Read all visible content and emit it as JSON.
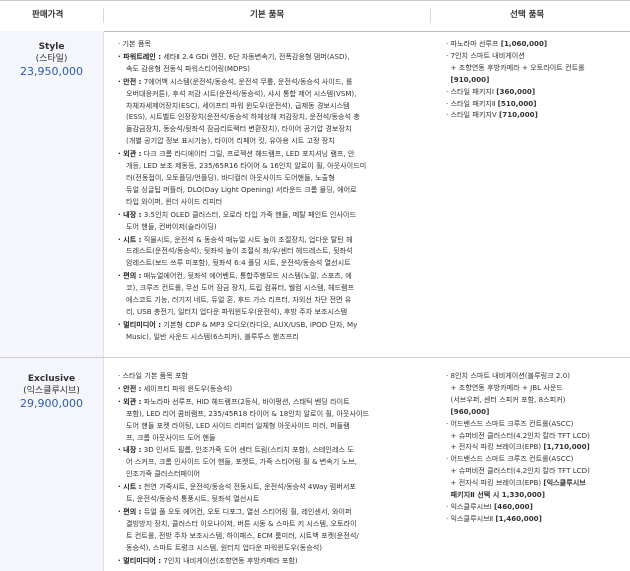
{
  "header": {
    "col1": "판매가격",
    "col2": "기본 품목",
    "col3": "선택 품목"
  },
  "rows": [
    {
      "trim": "Style",
      "trim_ko": "(스타일)",
      "price": "23,950,000",
      "basic": [
        {
          "b": "",
          "t": "· 기본 품목"
        },
        {
          "b": "· 파워트레인 :",
          "t": " 세타Ⅱ 2.4 GDi 엔진, 6단 자동변속기, 전폭감응형 댐퍼(ASD),"
        },
        {
          "b": "",
          "t": "속도 감응형 전동식 파워스티어링(MDPS)",
          "i": 1
        },
        {
          "b": "· 안전 :",
          "t": " 7에어백 시스템(운전석/동승석, 운전석 무릎, 운전석/동승석 사이드, 롤"
        },
        {
          "b": "",
          "t": "오버대응커튼), 후석 저감 시트(운전석/동승석), 샤시 통합 제어 시스템(VSM),",
          "i": 1
        },
        {
          "b": "",
          "t": "차체자세제어장치(ESC), 세이프티 파워 윈도우(운전석), 급제동 경보시스템",
          "i": 1
        },
        {
          "b": "",
          "t": "(ESS), 시트벨트 인장장치(운전석/동승석 하체상해 저감장치, 운전석/동승석 충",
          "i": 1
        },
        {
          "b": "",
          "t": "돌감금장치, 동승석/뒷좌석 잠금리트랙터 변환장치), 타이어 공기압 경보장치",
          "i": 1
        },
        {
          "b": "",
          "t": "(개별 공기압 정보 표시기능), 타이어 리페어 킷, 유아용 시트 고정 장치",
          "i": 1
        },
        {
          "b": "· 외관 :",
          "t": " 다크 크롬 라디에이터 그릴, 프로젝션 헤드램프, LED 포지셔닝 램프, 안"
        },
        {
          "b": "",
          "t": "개등, LED 보조 제동등, 235/65R16 타이어 & 16인치 알로이 휠, 아웃사이드미",
          "i": 1
        },
        {
          "b": "",
          "t": "러(전동접이, 오토플딩/언플딩), 바디컬러 아웃사이드 도어핸들, 노출형",
          "i": 1
        },
        {
          "b": "",
          "t": "듀얼 싱글팁 머플러, DLO(Day Light Opening) 서라운드 크롬 몰딩, 에어로",
          "i": 1
        },
        {
          "b": "",
          "t": "타입 와이퍼, 윈더 사이드 리피터",
          "i": 1
        },
        {
          "b": "· 내장 :",
          "t": " 3.5인치 OLED 클러스터, 오로라 타입 가죽 핸들, 메탈 페인트 인사이드"
        },
        {
          "b": "",
          "t": "도어 핸들, 컨버이저(슬라이딩)",
          "i": 1
        },
        {
          "b": "· 시트 :",
          "t": " 직물시트, 운전석 & 동승석 매뉴얼 시트 높이 조절장치, 업다운 탈틴 헤"
        },
        {
          "b": "",
          "t": "드레스트(운전석/동승석), 뒷좌석 높이 조절식 좌/우/센터 헤드레스트, 뒷좌석",
          "i": 1
        },
        {
          "b": "",
          "t": "암레스트(보드 쓰루 미포함), 뒷좌석 6:4 폴딩 시트, 운전석/동승석 열선시트",
          "i": 1
        },
        {
          "b": "· 편의 :",
          "t": " 매뉴얼에어컨, 뒷좌석 에어벤트, 통합주행모드 시스템(노말, 스포츠, 에"
        },
        {
          "b": "",
          "t": "코), 크루즈 컨트롤, 무선 도어 잠금 장치, 트립 컴퓨터, 웰컴 시스템, 헤드램프",
          "i": 1
        },
        {
          "b": "",
          "t": "에스코트 기능, 러기지 네트, 듀얼 혼, 후드 가스 리프터, 자외선 차단 전면 유",
          "i": 1
        },
        {
          "b": "",
          "t": "리, USB 충전기, 일터치 업다운 파워윈도우(운전석), 후방 주차 보조시스템",
          "i": 1
        },
        {
          "b": "· 멀티미디어 :",
          "t": " 기본형 CDP & MP3 오디오(라디오, AUX/USB, iPOD 단자, My"
        },
        {
          "b": "",
          "t": "Music), 일반 사운드 시스템(6스피커), 블루투스 핸즈프리",
          "i": 1
        }
      ],
      "options": [
        {
          "t": "· 파노라마 선루프 ",
          "p": "[1,060,000]"
        },
        {
          "t": "· 7인치 스마트 내비게이션",
          "p": ""
        },
        {
          "t": "  + 조향연동 후방카메라 + 오토라이트 컨트롤",
          "p": ""
        },
        {
          "t": "  ",
          "p": "[910,000]"
        },
        {
          "t": "· 스타일 패키지Ⅰ ",
          "p": "[360,000]"
        },
        {
          "t": "· 스타일 패키지Ⅱ ",
          "p": "[510,000]"
        },
        {
          "t": "· 스타일 패키지Ⅴ ",
          "p": "[710,000]"
        }
      ]
    },
    {
      "trim": "Exclusive",
      "trim_ko": "(익스클루시브)",
      "price": "29,900,000",
      "basic": [
        {
          "b": "",
          "t": "· 스타일 기본 품목 포함"
        },
        {
          "b": "· 안전 :",
          "t": " 세이프티 파워 윈도우(동승석)"
        },
        {
          "b": "· 외관 :",
          "t": " 파노라마 선루프, HID 헤드램프(2등식, 바이펑션, 스태틱 벤딩 라이트"
        },
        {
          "b": "",
          "t": "포함), LED 리어 콤비램프, 235/45R18 타이어 & 18인치 알로이 휠, 아웃사이드",
          "i": 1
        },
        {
          "b": "",
          "t": "도어 핸들 포켓 라이팅, LED 사이드 리피터 일체형 아웃사이드 미러, 퍼들램",
          "i": 1
        },
        {
          "b": "",
          "t": "프, 크롬 아웃사이드 도어 핸들",
          "i": 1
        },
        {
          "b": "· 내장 :",
          "t": " 3D 인서트 필름, 인조가죽 도어 센터 트림(스티치 포함), 스테인레스 도"
        },
        {
          "b": "",
          "t": "어 스커프, 크롬 인사이드 도어 핸들, 포켓트, 가죽 스티어링 휠 & 변속기 노브,",
          "i": 1
        },
        {
          "b": "",
          "t": "인조가죽 클러스터페이어",
          "i": 1
        },
        {
          "b": "· 시트 :",
          "t": " 천연 가죽시트, 운전석/동승석 전동시트, 운전석/동승석 4Way 럼버서포"
        },
        {
          "b": "",
          "t": "트, 운전석/동승석 통풍시트, 뒷좌석 열선시트",
          "i": 1
        },
        {
          "b": "· 편의 :",
          "t": " 듀얼 풀 오토 에어컨, 오토 디포그, 열선 스티어링 휠, 레인센서, 와이퍼"
        },
        {
          "b": "",
          "t": "결빙방지 장치, 클러스터 이오나이저, 버튼 시동 & 스마트 키 시스템, 오토라이",
          "i": 1
        },
        {
          "b": "",
          "t": "트 컨트롤, 전방 주차 보조시스템, 하이패스, ECM 룸미러, 시트백 포켓(운전석/",
          "i": 1
        },
        {
          "b": "",
          "t": "동승석), 스마트 트렁크 시스템, 원터치 업다운 파워윈도우(동승석)",
          "i": 1
        },
        {
          "b": "· 멀티미디어 :",
          "t": " 7인치 내비게이션(조향연동 후방카메라 포함)"
        }
      ],
      "options": [
        {
          "t": "· 8인치 스마트 내비게이션(블루링크 2.0)",
          "p": ""
        },
        {
          "t": "  + 조향연동 후방카메라 + JBL 사운드",
          "p": ""
        },
        {
          "t": "  (서브우퍼, 센터 스피커 포함, 8스피커)",
          "p": ""
        },
        {
          "t": "  ",
          "p": "[960,000]"
        },
        {
          "t": "· 어드밴스드 스마트 크루즈 컨트롤(ASCC)",
          "p": ""
        },
        {
          "t": "  + 슈퍼비전 클러스터(4.2인치 칼라 TFT LCD)",
          "p": ""
        },
        {
          "t": "  + 전자식 파킹 브레이크(EPB) ",
          "p": "[1,710,000]"
        },
        {
          "t": "· 어드밴스드 스마트 크루즈 컨트롤(ASCC)",
          "p": ""
        },
        {
          "t": "  + 슈퍼비전 클러스터(4.2인치 칼라 TFT LCD)",
          "p": ""
        },
        {
          "t": "  + 전자식 파킹 브레이크(EPB) ",
          "p": "[익스클루시브"
        },
        {
          "t": "  ",
          "p": "패키지Ⅱ 선택 시 1,330,000]"
        },
        {
          "t": "· 익스클루시브Ⅰ ",
          "p": "[460,000]"
        },
        {
          "t": "· 익스클루시브Ⅱ ",
          "p": "[1,460,000]"
        }
      ]
    }
  ]
}
